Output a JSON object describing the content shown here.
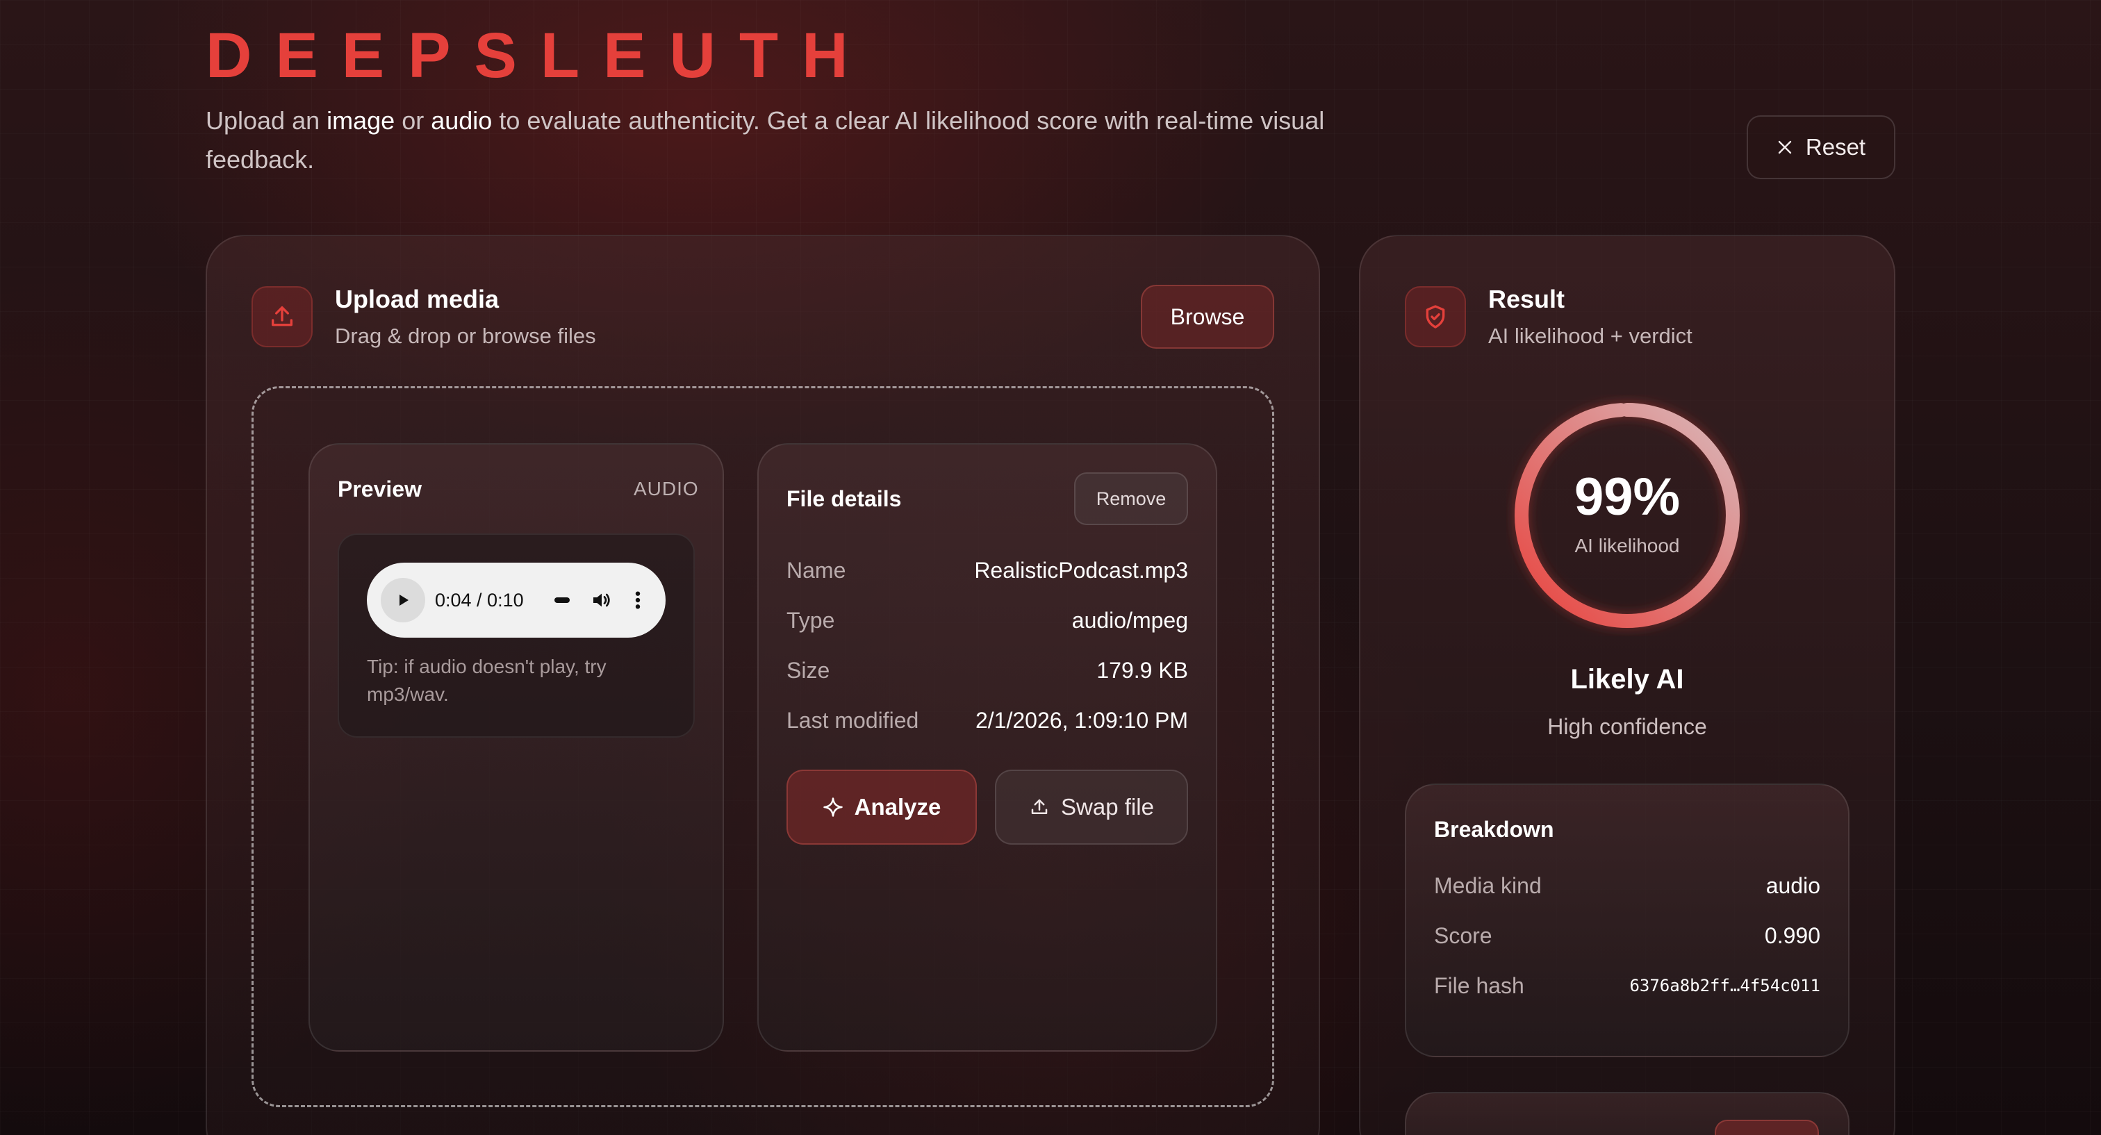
{
  "app": {
    "brand": "DEEPSLEUTH",
    "subtitle_pre": "Upload an ",
    "subtitle_image": "image",
    "subtitle_or": " or ",
    "subtitle_audio": "audio",
    "subtitle_post": " to evaluate authenticity. Get a clear AI likelihood score with real-time visual feedback."
  },
  "header": {
    "reset_label": "Reset"
  },
  "upload": {
    "title": "Upload media",
    "subtitle": "Drag & drop or browse files",
    "browse_label": "Browse"
  },
  "preview": {
    "title": "Preview",
    "kind": "AUDIO",
    "time": "0:04 / 0:10",
    "tip": "Tip: if audio doesn't play, try mp3/wav."
  },
  "details": {
    "title": "File details",
    "remove_label": "Remove",
    "rows": [
      {
        "key": "Name",
        "value": "RealisticPodcast.mp3"
      },
      {
        "key": "Type",
        "value": "audio/mpeg"
      },
      {
        "key": "Size",
        "value": "179.9 KB"
      },
      {
        "key": "Last modified",
        "value": "2/1/2026, 1:09:10 PM"
      }
    ],
    "analyze_label": "Analyze",
    "swap_label": "Swap file"
  },
  "result": {
    "title": "Result",
    "subtitle": "AI likelihood + verdict",
    "percent_label": "99%",
    "likelihood": 0.99,
    "percent_caption": "AI likelihood",
    "verdict": "Likely AI",
    "confidence": "High confidence"
  },
  "breakdown": {
    "title": "Breakdown",
    "rows": [
      {
        "key": "Media kind",
        "value": "audio"
      },
      {
        "key": "Score",
        "value": "0.990"
      },
      {
        "key": "File hash",
        "value": "6376a8b2ff…4f54c011"
      }
    ]
  },
  "colors": {
    "accent": "#e5403b",
    "background": "#1a1113",
    "gauge_start": "#e8433e",
    "gauge_end": "#d9b8ba"
  },
  "icons": {
    "reset": "close-icon",
    "upload": "upload-icon",
    "result": "shield-check-icon",
    "play": "play-icon",
    "volume": "volume-icon",
    "more": "more-vertical-icon",
    "analyze": "sparkle-icon",
    "swap": "upload-icon"
  }
}
